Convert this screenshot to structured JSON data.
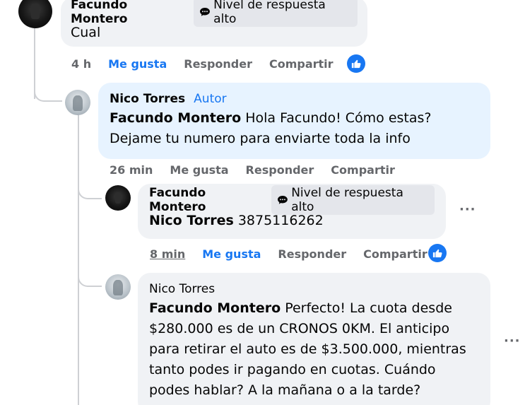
{
  "comments": [
    {
      "author": "Facundo Montero",
      "badge": "Nivel de respuesta alto",
      "text": "Cual",
      "time": "4 h",
      "like": "Me gusta",
      "reply": "Responder",
      "share": "Compartir"
    },
    {
      "author": "Nico Torres",
      "author_tag": "Autor",
      "mention": "Facundo Montero",
      "text_line1": "Hola Facundo! Cómo estas?",
      "text_line2": "Dejame tu numero para enviarte toda la info",
      "time": "26 min",
      "like": "Me gusta",
      "reply": "Responder",
      "share": "Compartir"
    },
    {
      "author": "Facundo Montero",
      "badge": "Nivel de respuesta alto",
      "mention": "Nico Torres",
      "text": "3875116262",
      "time": "8 min",
      "like": "Me gusta",
      "reply": "Responder",
      "share": "Compartir",
      "more": "···"
    },
    {
      "author": "Nico Torres",
      "mention": "Facundo Montero",
      "text_line1": "Perfecto! La cuota desde",
      "text_line2": "$280.000 es de un CRONOS 0KM. El anticipo",
      "text_line3": "para retirar el auto es de $3.500.000, mientras",
      "text_line4": "tanto podes ir pagando en cuotas. Cuándo",
      "text_line5": "podes hablar? A la mañana o a la tarde?",
      "more": "···"
    }
  ],
  "colors": {
    "accent": "#1877f2",
    "bubble": "#f0f2f5",
    "author_bubble": "#e7f3ff",
    "muted": "#65676b"
  },
  "icons": {
    "badge_icon": "chat-bubble-icon",
    "like_reaction": "thumbs-up-icon",
    "more": "more-options-icon"
  }
}
